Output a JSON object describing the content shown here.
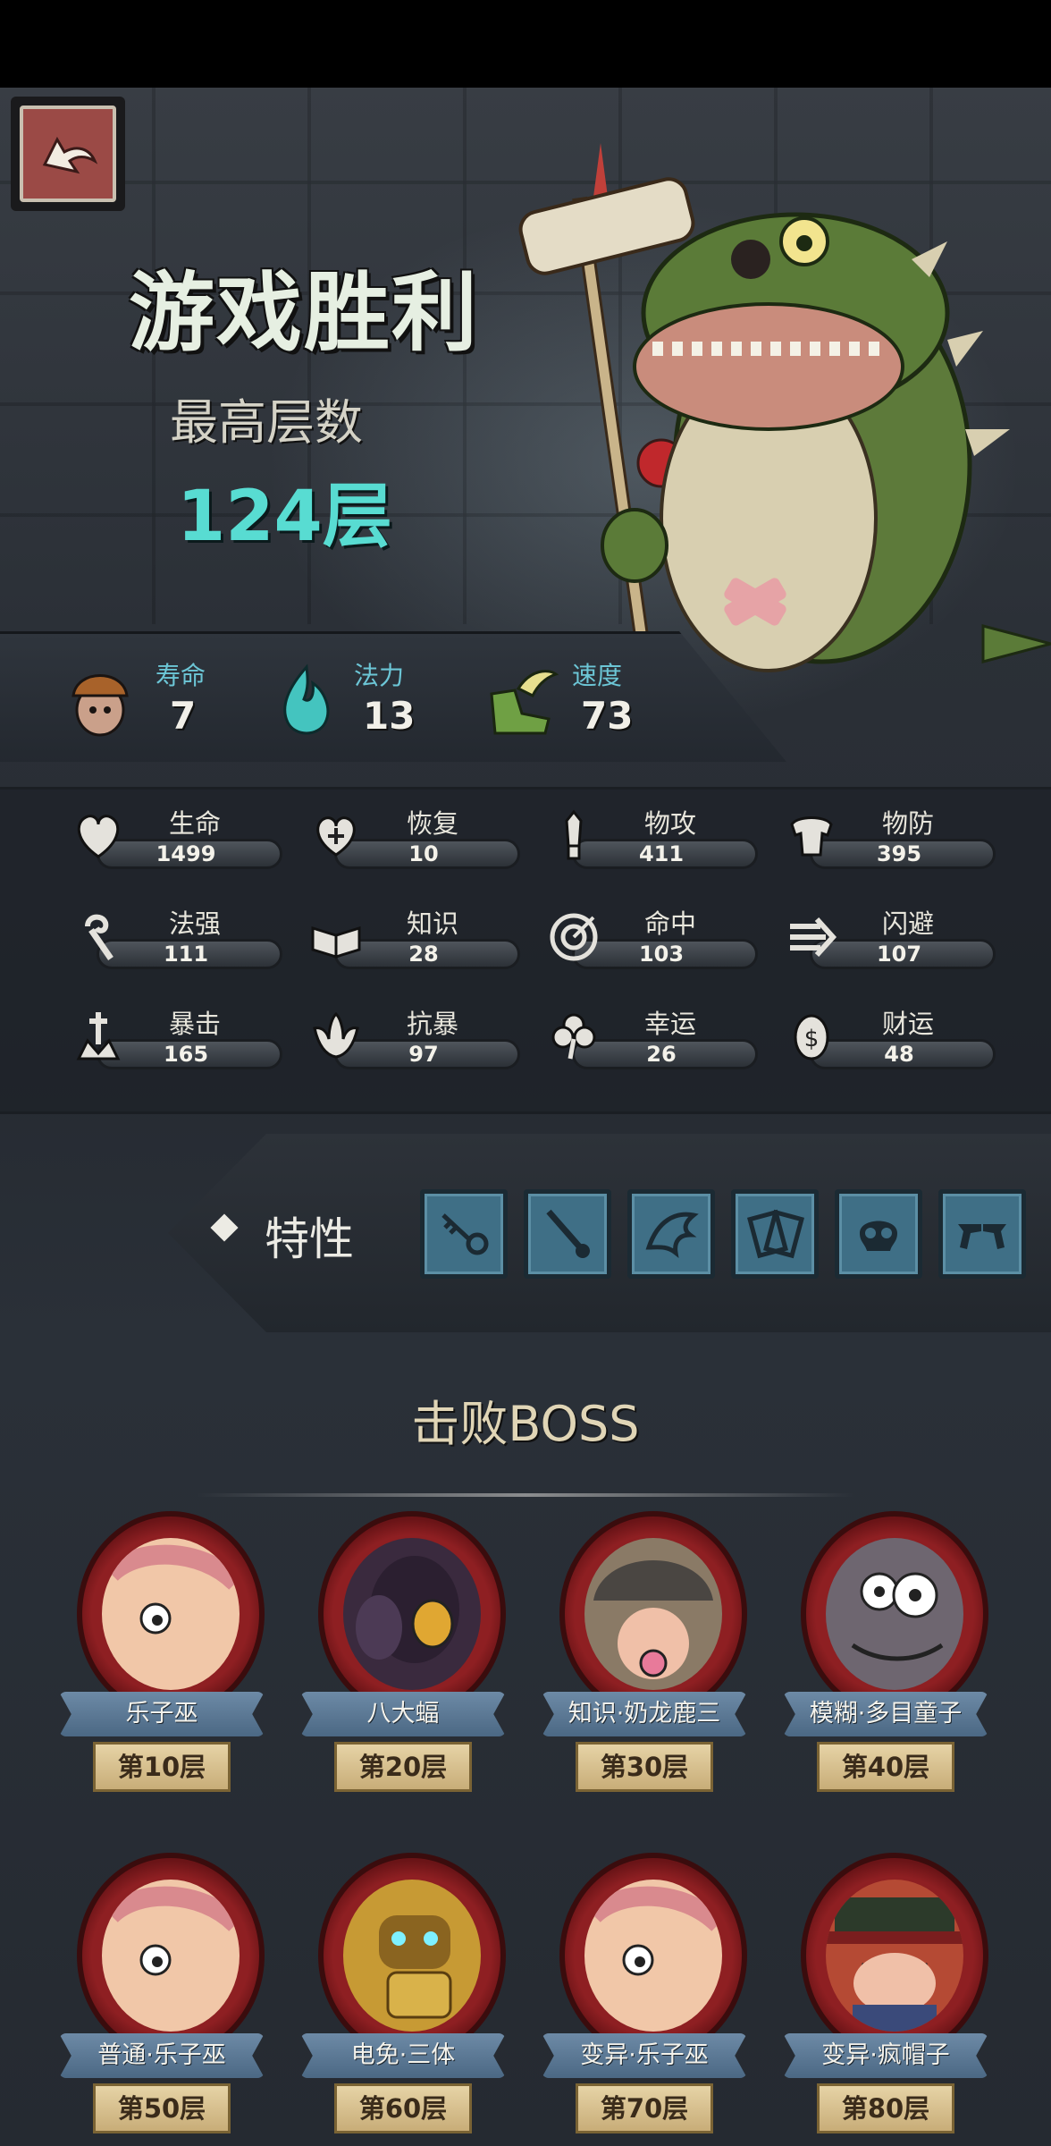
{
  "header": {
    "title": "游戏胜利",
    "subtitle": "最高层数",
    "max_floor": "124层"
  },
  "top_stats": [
    {
      "label": "寿命",
      "value": "7",
      "icon": "mushroom-kid-icon"
    },
    {
      "label": "法力",
      "value": "13",
      "icon": "blue-flame-icon"
    },
    {
      "label": "速度",
      "value": "73",
      "icon": "winged-boot-icon"
    }
  ],
  "attributes": [
    {
      "label": "生命",
      "value": "1499",
      "icon": "heart-icon"
    },
    {
      "label": "恢复",
      "value": "10",
      "icon": "heart-plus-icon"
    },
    {
      "label": "物攻",
      "value": "411",
      "icon": "sword-icon"
    },
    {
      "label": "物防",
      "value": "395",
      "icon": "armor-icon"
    },
    {
      "label": "法强",
      "value": "111",
      "icon": "staff-icon"
    },
    {
      "label": "知识",
      "value": "28",
      "icon": "book-icon"
    },
    {
      "label": "命中",
      "value": "103",
      "icon": "target-icon"
    },
    {
      "label": "闪避",
      "value": "107",
      "icon": "dash-arrow-icon"
    },
    {
      "label": "暴击",
      "value": "165",
      "icon": "crit-sword-icon"
    },
    {
      "label": "抗暴",
      "value": "97",
      "icon": "shell-icon"
    },
    {
      "label": "幸运",
      "value": "26",
      "icon": "clover-icon"
    },
    {
      "label": "财运",
      "value": "48",
      "icon": "coin-icon"
    }
  ],
  "traits": {
    "label": "特性",
    "items": [
      "key-trait-icon",
      "staff-trait-icon",
      "dragon-trait-icon",
      "cards-trait-icon",
      "skull-trait-icon",
      "pistols-trait-icon"
    ]
  },
  "bosses": {
    "title": "击败BOSS",
    "items": [
      {
        "name": "乐子巫",
        "floor": "第10层",
        "color": "#f1c7a8"
      },
      {
        "name": "八大蝠",
        "floor": "第20层",
        "color": "#3a2a3e"
      },
      {
        "name": "知识·奶龙鹿三",
        "floor": "第30层",
        "color": "#8a7a66"
      },
      {
        "name": "模糊·多目童子",
        "floor": "第40层",
        "color": "#6e6670"
      },
      {
        "name": "普通·乐子巫",
        "floor": "第50层",
        "color": "#f1c7a8"
      },
      {
        "name": "电免·三体",
        "floor": "第60层",
        "color": "#c79a34"
      },
      {
        "name": "变异·乐子巫",
        "floor": "第70层",
        "color": "#f1c7a8"
      },
      {
        "name": "变异·疯帽子",
        "floor": "第80层",
        "color": "#b54a34"
      }
    ]
  }
}
